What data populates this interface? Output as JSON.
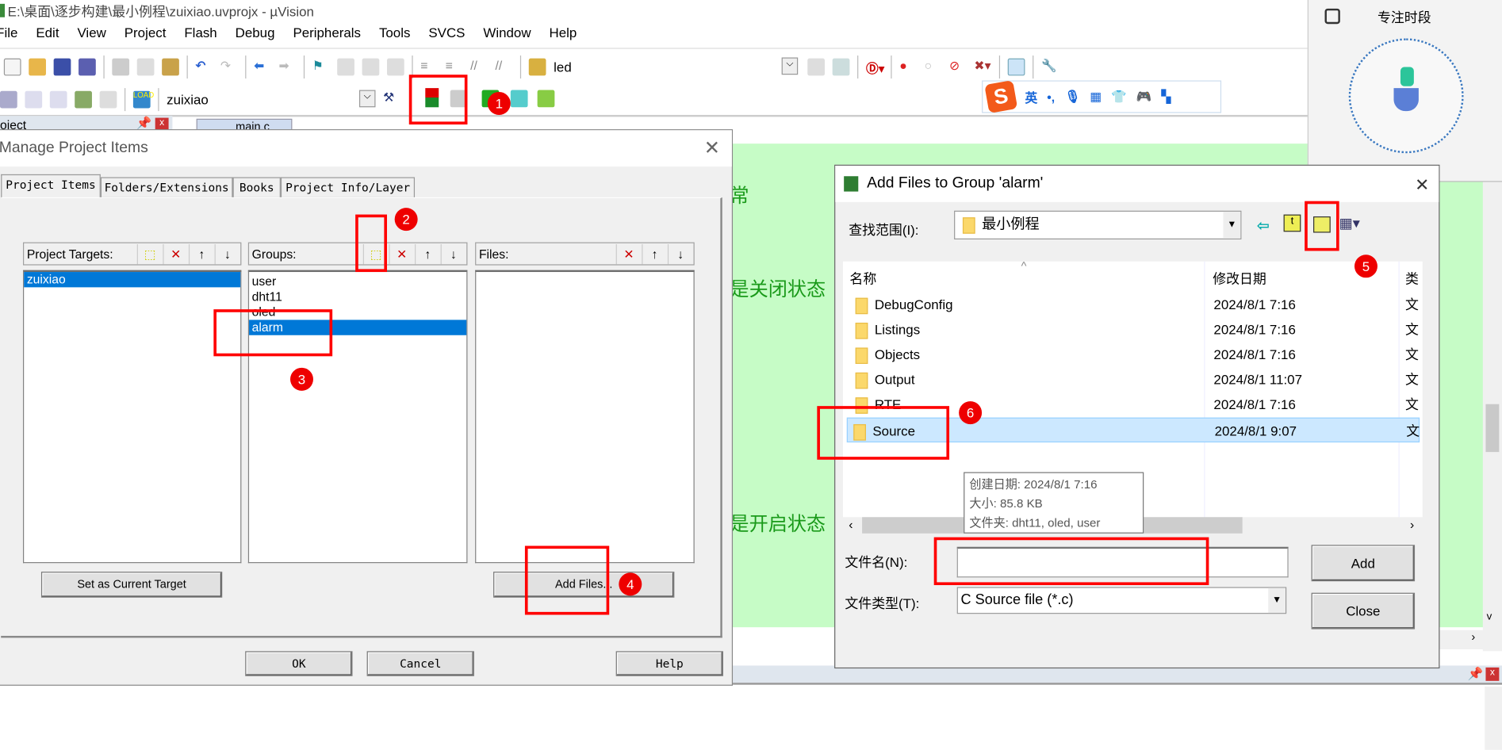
{
  "window": {
    "title": "E:\\桌面\\逐步构建\\最小例程\\zuixiao.uvprojx - µVision"
  },
  "menu": [
    "File",
    "Edit",
    "View",
    "Project",
    "Flash",
    "Debug",
    "Peripherals",
    "Tools",
    "SVCS",
    "Window",
    "Help"
  ],
  "toolbar": {
    "find_value": "led",
    "target_value": "zuixiao"
  },
  "project_panel": {
    "title": "oject",
    "tab": "main.c"
  },
  "editor": {
    "bg": "#c6fcc6",
    "lines": [
      "常",
      "是关闭状态",
      "是开启状态"
    ]
  },
  "ime": {
    "logo": "S",
    "mode": "英",
    "punct": "•,"
  },
  "focus_widget": {
    "title": "专注时段"
  },
  "manage": {
    "title": "Manage Project Items",
    "tabs": [
      "Project Items",
      "Folders/Extensions",
      "Books",
      "Project Info/Layer"
    ],
    "targets_label": "Project Targets:",
    "targets": [
      "zuixiao"
    ],
    "groups_label": "Groups:",
    "groups": [
      "user",
      "dht11",
      "oled",
      "alarm"
    ],
    "selected_group": "alarm",
    "files_label": "Files:",
    "set_target": "Set as Current Target",
    "add_files": "Add Files...",
    "ok": "OK",
    "cancel": "Cancel",
    "help": "Help"
  },
  "addfiles": {
    "title": "Add Files to Group 'alarm'",
    "look_in_label": "查找范围(I):",
    "look_in": "最小例程",
    "col_name": "名称",
    "col_date": "修改日期",
    "col_type": "类",
    "rows": [
      {
        "name": "DebugConfig",
        "date": "2024/8/1 7:16",
        "type": "文"
      },
      {
        "name": "Listings",
        "date": "2024/8/1 7:16",
        "type": "文"
      },
      {
        "name": "Objects",
        "date": "2024/8/1 7:16",
        "type": "文"
      },
      {
        "name": "Output",
        "date": "2024/8/1 11:07",
        "type": "文"
      },
      {
        "name": "RTE",
        "date": "2024/8/1 7:16",
        "type": "文"
      },
      {
        "name": "Source",
        "date": "2024/8/1 9:07",
        "type": "文"
      }
    ],
    "selected": "Source",
    "tooltip": [
      "创建日期: 2024/8/1 7:16",
      "大小: 85.8 KB",
      "文件夹: dht11, oled, user"
    ],
    "filename_label": "文件名(N):",
    "filename": "",
    "filetype_label": "文件类型(T):",
    "filetype": "C Source file (*.c)",
    "add": "Add",
    "close": "Close"
  },
  "annotations": [
    "1",
    "2",
    "3",
    "4",
    "5",
    "6"
  ],
  "colors": {
    "highlight": "#0078d7",
    "annotation": "#ff0000",
    "row_selected": "#cce8ff"
  }
}
